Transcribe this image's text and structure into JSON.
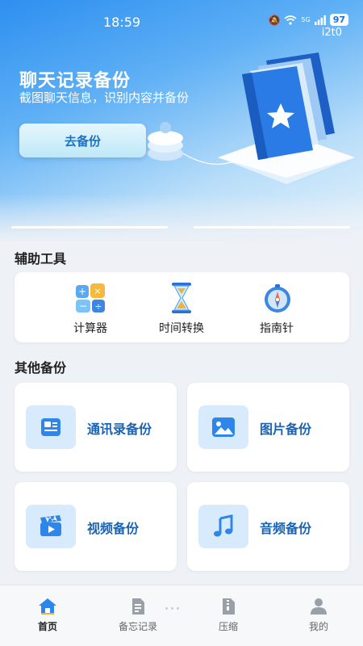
{
  "status_bar": {
    "time": "18:59",
    "signal_label": "5G",
    "battery": "97",
    "watermark": "i2t0"
  },
  "hero": {
    "title": "聊天记录备份",
    "subtitle": "截图聊天信息，识别内容并备份",
    "button_label": "去备份"
  },
  "tools": {
    "title": "辅助工具",
    "items": [
      {
        "label": "计算器",
        "icon": "calculator-icon"
      },
      {
        "label": "时间转换",
        "icon": "hourglass-icon"
      },
      {
        "label": "指南针",
        "icon": "compass-icon"
      }
    ]
  },
  "other_backup": {
    "title": "其他备份",
    "items": [
      {
        "label": "通讯录备份",
        "icon": "contacts-icon"
      },
      {
        "label": "图片备份",
        "icon": "image-icon"
      },
      {
        "label": "视频备份",
        "icon": "video-icon"
      },
      {
        "label": "音频备份",
        "icon": "music-icon"
      }
    ]
  },
  "bottom_nav": {
    "items": [
      {
        "label": "首页",
        "icon": "home-icon",
        "active": true
      },
      {
        "label": "备忘记录",
        "icon": "memo-icon",
        "active": false
      },
      {
        "label": "压缩",
        "icon": "zip-icon",
        "active": false
      },
      {
        "label": "我的",
        "icon": "user-icon",
        "active": false
      }
    ]
  },
  "colors": {
    "accent": "#1b73d4",
    "hero_gradient_start": "#2d8ff0",
    "card_label": "#1b63b5",
    "icon_bg": "#d8ebfc"
  }
}
